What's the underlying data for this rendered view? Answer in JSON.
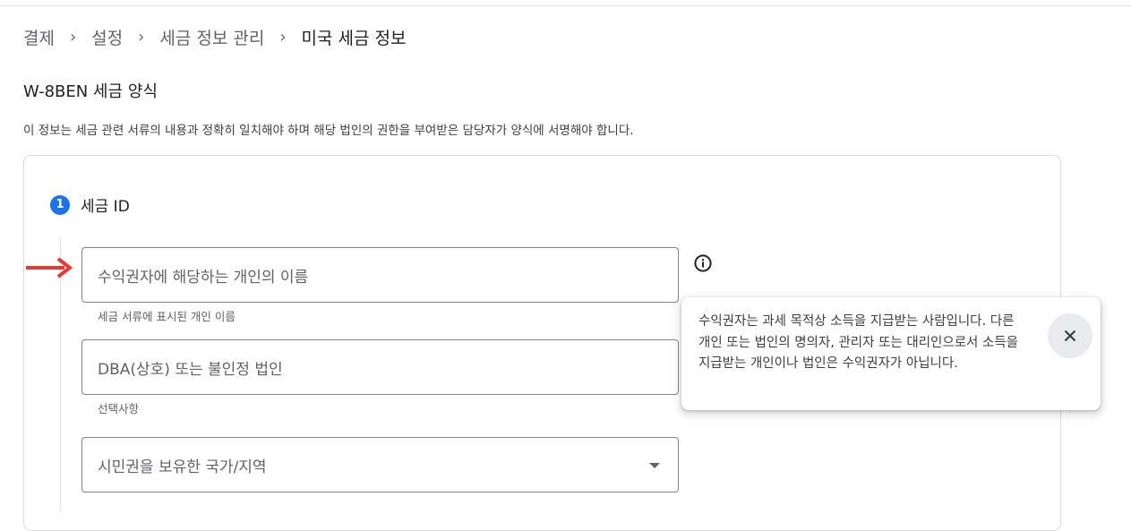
{
  "breadcrumb": {
    "items": [
      "결제",
      "설정",
      "세금 정보 관리"
    ],
    "current": "미국 세금 정보",
    "separator": "›"
  },
  "form": {
    "title": "W-8BEN 세금 양식",
    "description": "이 정보는 세금 관련 서류의 내용과 정확히 일치해야 하며 해당 법인의 권한을 부여받은 담당자가 양식에 서명해야 합니다."
  },
  "step": {
    "number": "1",
    "title": "세금 ID"
  },
  "fields": {
    "beneficiary_name": {
      "placeholder": "수익권자에 해당하는 개인의 이름",
      "helper": "세금 서류에 표시된 개인 이름"
    },
    "dba_name": {
      "placeholder": "DBA(상호) 또는 불인정 법인",
      "helper": "선택사항"
    },
    "citizenship_country": {
      "placeholder": "시민권을 보유한 국가/지역"
    }
  },
  "tooltip": {
    "text": "수익권자는 과세 목적상 소득을 지급받는 사람입니다. 다른 개인 또는 법인의 명의자, 관리자 또는 대리인으로서 소득을 지급받는 개인이나 법인은 수익권자가 아닙니다."
  },
  "icons": {
    "info": "info-icon",
    "close": "close-icon",
    "dropdown": "dropdown-caret-icon",
    "annotation": "red-arrow-icon"
  },
  "colors": {
    "accent": "#1a73e8",
    "annotation": "#e53935"
  }
}
